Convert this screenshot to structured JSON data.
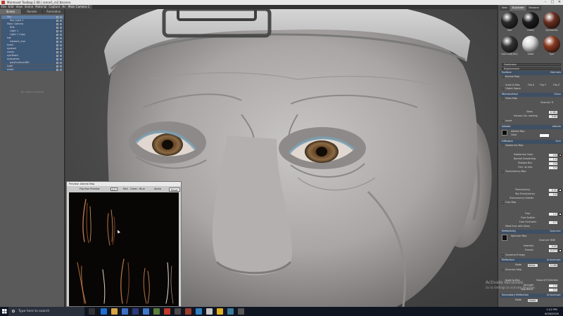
{
  "window": {
    "title": "Marmoset Toolbag 2.08 | scene1_m2.tbscene",
    "min_label": "–",
    "max_label": "□",
    "close_label": "✕"
  },
  "menu": [
    "File",
    "Edit",
    "View",
    "Scene",
    "Material",
    "Capture",
    "Help"
  ],
  "left_panel": {
    "tabs": [
      "Scene",
      "Render",
      "Animation"
    ],
    "active_tab": "Scene",
    "tree": [
      {
        "label": "Sky",
        "depth": 1,
        "selected": true
      },
      {
        "label": "Sky Light 1",
        "depth": 2
      },
      {
        "label": "Main Camera",
        "depth": 1
      },
      {
        "label": "RIM",
        "depth": 2
      },
      {
        "label": "Light 1",
        "depth": 2
      },
      {
        "label": "Light 1 Copy",
        "depth": 2
      },
      {
        "label": "hat",
        "depth": 1
      },
      {
        "label": "hatbrim_5un",
        "depth": 2
      },
      {
        "label": "head",
        "depth": 1
      },
      {
        "label": "eyeball",
        "depth": 1
      },
      {
        "label": "cones",
        "depth": 1
      },
      {
        "label": "eyeTeeth",
        "depth": 1
      },
      {
        "label": "eyelashes",
        "depth": 1
      },
      {
        "label": "polySurface469",
        "depth": 2
      },
      {
        "label": "Look",
        "depth": 1
      },
      {
        "label": "mesh",
        "depth": 1
      }
    ],
    "empty_label": "No object selected"
  },
  "viewport": {
    "tab_label": "Main Camera 1"
  },
  "preview": {
    "title": "Preview: Albedo Map",
    "flip_label": "Flip Box Preview",
    "zoom_value": "0.0",
    "channels": [
      "Red",
      "Green",
      "Blue",
      "Alpha"
    ],
    "reset_label": "Reset"
  },
  "right_panel": {
    "tabs": [
      "New",
      "Duplicate",
      "Rename"
    ],
    "materials": [
      {
        "label": "hair",
        "color": "#2a2a2a"
      },
      {
        "label": "mesh",
        "color": "#1c1c1c"
      },
      {
        "label": "eyelashes",
        "color": "#6a3020"
      },
      {
        "label": "hat-mult(mn)",
        "color": "#333333"
      },
      {
        "label": "head",
        "color": "#d8d8d8"
      },
      {
        "label": "Eye",
        "color": "#8a3a22"
      }
    ],
    "top_dropdowns": [
      "Subdivision",
      "Displacement"
    ],
    "sections": {
      "surface": {
        "title": "Surface",
        "mode": "Normals",
        "normal_map": "Normal Map",
        "scale_bias": "Scale & Bias",
        "flip_x": "Flip X",
        "flip_y": "Flip Y",
        "flip_z": "Flip Z",
        "object_space": "Object Space"
      },
      "microsurface": {
        "title": "Microsurface",
        "mode": "Gloss",
        "gloss_map": "Gloss Map",
        "channel": "Channel: R",
        "gloss": "Gloss",
        "gloss_value": "0.381",
        "horizon": "Horizon Sm. nothing",
        "horizon_value": "0.60",
        "invert": "Invert"
      },
      "albedo": {
        "title": "Albedo",
        "mode": "Albedo",
        "albedo_map": "Albedo Map",
        "color_label": "Color"
      },
      "diffusion": {
        "title": "Diffusion",
        "mode": "Skin",
        "subdermis_map": "Subdermis Map",
        "subdermis_color": "Subdermis Color",
        "normal_smoothing": "Normal Smoothing",
        "shadow_blur": "Shadow Blur",
        "occlusion_blur": "Occl. on blur",
        "translucency_map": "Translucency Map",
        "translucency_color": "Translucency",
        "sky_translucency": "Sky Translucency",
        "translucency_scatter": "Translucency Scatter",
        "fuzz_map": "Fuzz Map",
        "fuzz": "Fuzz",
        "fuzz_scatter": "Fuzz Scatter",
        "fuzz_occlusion": "Fuzz Occlusion",
        "mask_fuzz": "Mask Fuzz with Gloss",
        "values": [
          "0.6",
          "1.0",
          "0.6",
          "0.9",
          "0.55",
          "0.8",
          "1.0",
          "0.7"
        ]
      },
      "reflectivity": {
        "title": "Reflectivity",
        "mode": "Specular",
        "specular_map": "Specular Map",
        "channel": "Channel: RGB",
        "intensity": "Intensity",
        "intensity_value": "0.00",
        "fresnel": "Fresnel",
        "fresnel_value": "0.277",
        "conserve": "Conserve Energy"
      },
      "reflection": {
        "title": "Reflection",
        "mode": "Anisotropic",
        "mode_label": "Mode",
        "direction_map": "Direction Map",
        "mode_value": "Aniso",
        "value": "0.188",
        "scale_bias": "Scale & Bias",
        "swap": "Swap X/Y Direction",
        "strength": "Strength",
        "strength_value": "1.0",
        "map_blend": "Map Blend",
        "map_blend_value": "0.5"
      },
      "secondary": {
        "title": "Secondary Reflection",
        "mode": "Anisotropic",
        "mode_label": "Mode",
        "mode_value": "Linear"
      }
    }
  },
  "activate_windows": {
    "title": "Activate Windows",
    "subtitle": "Go to Settings to activate Windows."
  },
  "taskbar": {
    "search_placeholder": "Type here to search",
    "time": "1:22 PM",
    "date": "6/18/2018"
  }
}
